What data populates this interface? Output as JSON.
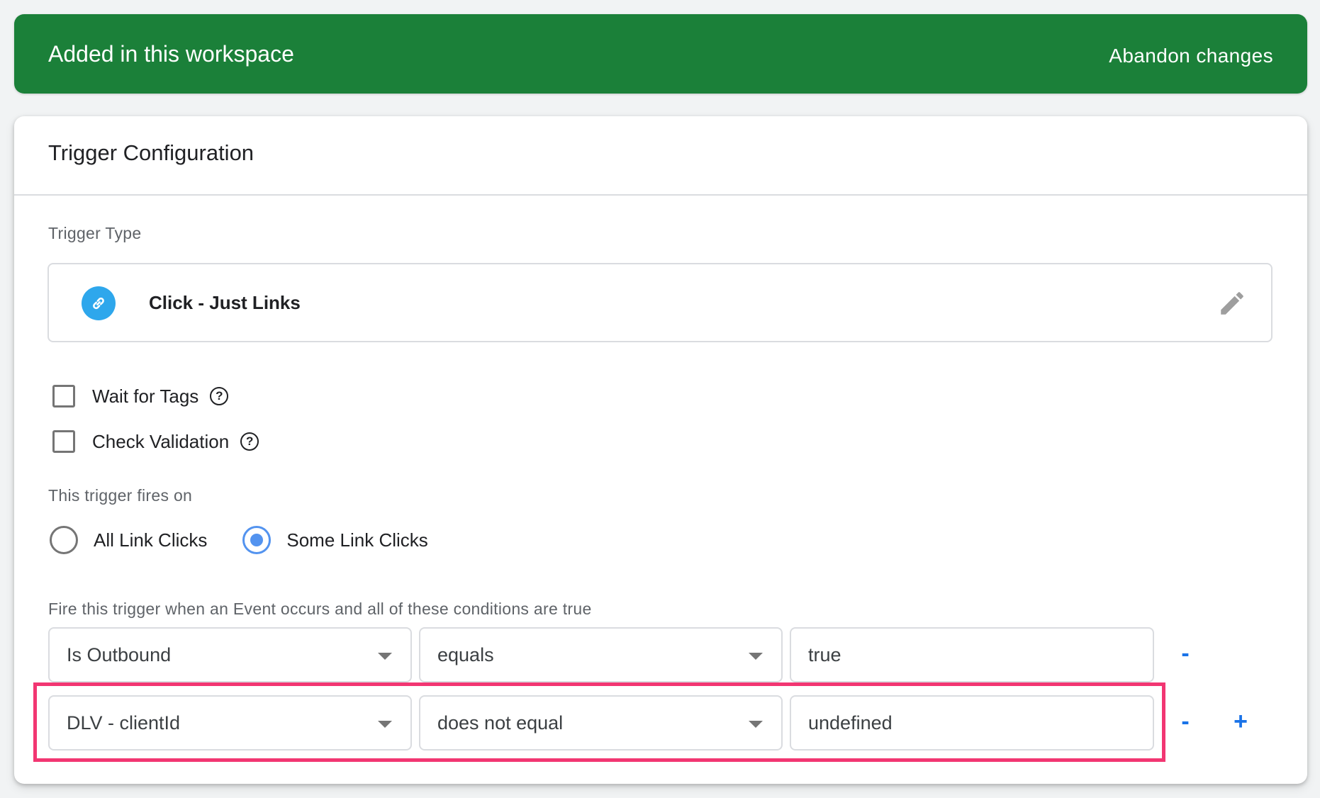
{
  "banner": {
    "title": "Added in this workspace",
    "action_label": "Abandon changes",
    "color": "#1b8039"
  },
  "card": {
    "title": "Trigger Configuration",
    "trigger_type": {
      "label": "Trigger Type",
      "name": "Click - Just Links",
      "icon": "link-icon",
      "icon_color": "#2ea7ec",
      "edit_icon": "pencil-icon"
    },
    "options": [
      {
        "label": "Wait for Tags",
        "checked": false,
        "help_icon": "help-circle-icon"
      },
      {
        "label": "Check Validation",
        "checked": false,
        "help_icon": "help-circle-icon"
      }
    ],
    "fires_on": {
      "label": "This trigger fires on",
      "choices": [
        {
          "label": "All Link Clicks",
          "selected": false
        },
        {
          "label": "Some Link Clicks",
          "selected": true
        }
      ],
      "accent": "#5393ef"
    },
    "conditions": {
      "label": "Fire this trigger when an Event occurs and all of these conditions are true",
      "rows": [
        {
          "variable": "Is Outbound",
          "operator": "equals",
          "value": "true",
          "remove_label": "-",
          "add_label": null
        },
        {
          "variable": "DLV - clientId",
          "operator": "does not equal",
          "value": "undefined",
          "remove_label": "-",
          "add_label": "+",
          "highlighted": true
        }
      ],
      "highlight_color": "#f23672"
    }
  }
}
